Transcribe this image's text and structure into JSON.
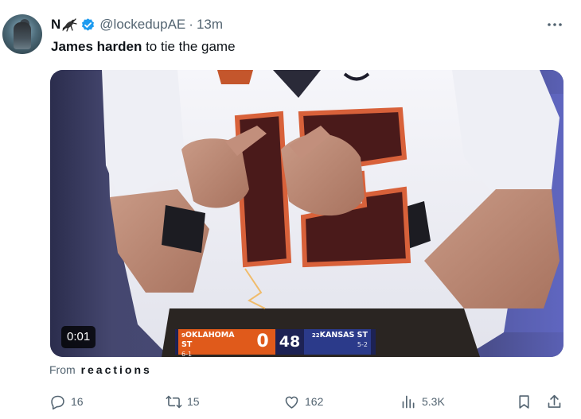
{
  "author": {
    "display_name": "N",
    "emoji": "🦗",
    "handle": "@lockedupAE",
    "separator": "·",
    "time": "13m"
  },
  "tweet": {
    "text_bold": "James harden",
    "text_rest": " to tie the game"
  },
  "media": {
    "duration": "0:01",
    "scorebug": {
      "team1_rank": "9",
      "team1_name": "OKLAHOMA ST",
      "team1_record": "6-1",
      "team1_score": "0",
      "team2_score": "48",
      "team2_rank": "22",
      "team2_name": "KANSAS ST",
      "team2_record": "5-2"
    }
  },
  "source": {
    "prefix": "From",
    "name": "reactions"
  },
  "actions": {
    "replies": "16",
    "reposts": "15",
    "likes": "162",
    "views": "5.3K"
  },
  "icons": [
    "avatar",
    "emoji-icon",
    "verified-icon",
    "more-icon",
    "reply-icon",
    "repost-icon",
    "like-icon",
    "views-icon",
    "bookmark-icon",
    "share-icon"
  ],
  "colors": {
    "verified": "#1d9bf0",
    "muted": "#536471",
    "team1": "#e05a1b",
    "team2": "#2b3a8a"
  }
}
